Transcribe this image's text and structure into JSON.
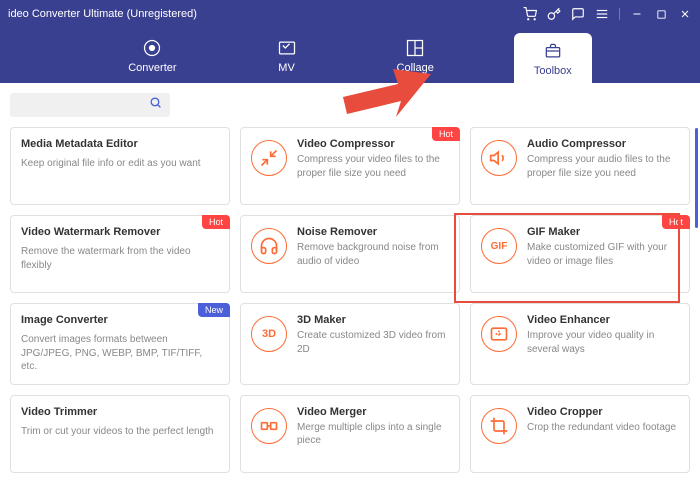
{
  "titlebar": {
    "title": "ideo Converter Ultimate (Unregistered)"
  },
  "nav": {
    "items": [
      {
        "label": "Converter"
      },
      {
        "label": "MV"
      },
      {
        "label": "Collage"
      },
      {
        "label": "Toolbox"
      }
    ]
  },
  "badges": {
    "hot": "Hot",
    "new": "New"
  },
  "cards": {
    "meta": {
      "title": "Media Metadata Editor",
      "desc": "Keep original file info or edit as you want"
    },
    "vcomp": {
      "title": "Video Compressor",
      "desc": "Compress your video files to the proper file size you need"
    },
    "acomp": {
      "title": "Audio Compressor",
      "desc": "Compress your audio files to the proper file size you need"
    },
    "watermark": {
      "title": "Video Watermark Remover",
      "desc": "Remove the watermark from the video flexibly"
    },
    "noise": {
      "title": "Noise Remover",
      "desc": "Remove background noise from audio of video"
    },
    "gif": {
      "title": "GIF Maker",
      "desc": "Make customized GIF with your video or image files",
      "icon_label": "GIF"
    },
    "imgconv": {
      "title": "Image Converter",
      "desc": "Convert images formats between JPG/JPEG, PNG, WEBP, BMP, TIF/TIFF, etc."
    },
    "3d": {
      "title": "3D Maker",
      "desc": "Create customized 3D video from 2D",
      "icon_label": "3D"
    },
    "enhancer": {
      "title": "Video Enhancer",
      "desc": "Improve your video quality in several ways"
    },
    "trimmer": {
      "title": "Video Trimmer",
      "desc": "Trim or cut your videos to the perfect length"
    },
    "merger": {
      "title": "Video Merger",
      "desc": "Merge multiple clips into a single piece"
    },
    "cropper": {
      "title": "Video Cropper",
      "desc": "Crop the redundant video footage"
    }
  }
}
